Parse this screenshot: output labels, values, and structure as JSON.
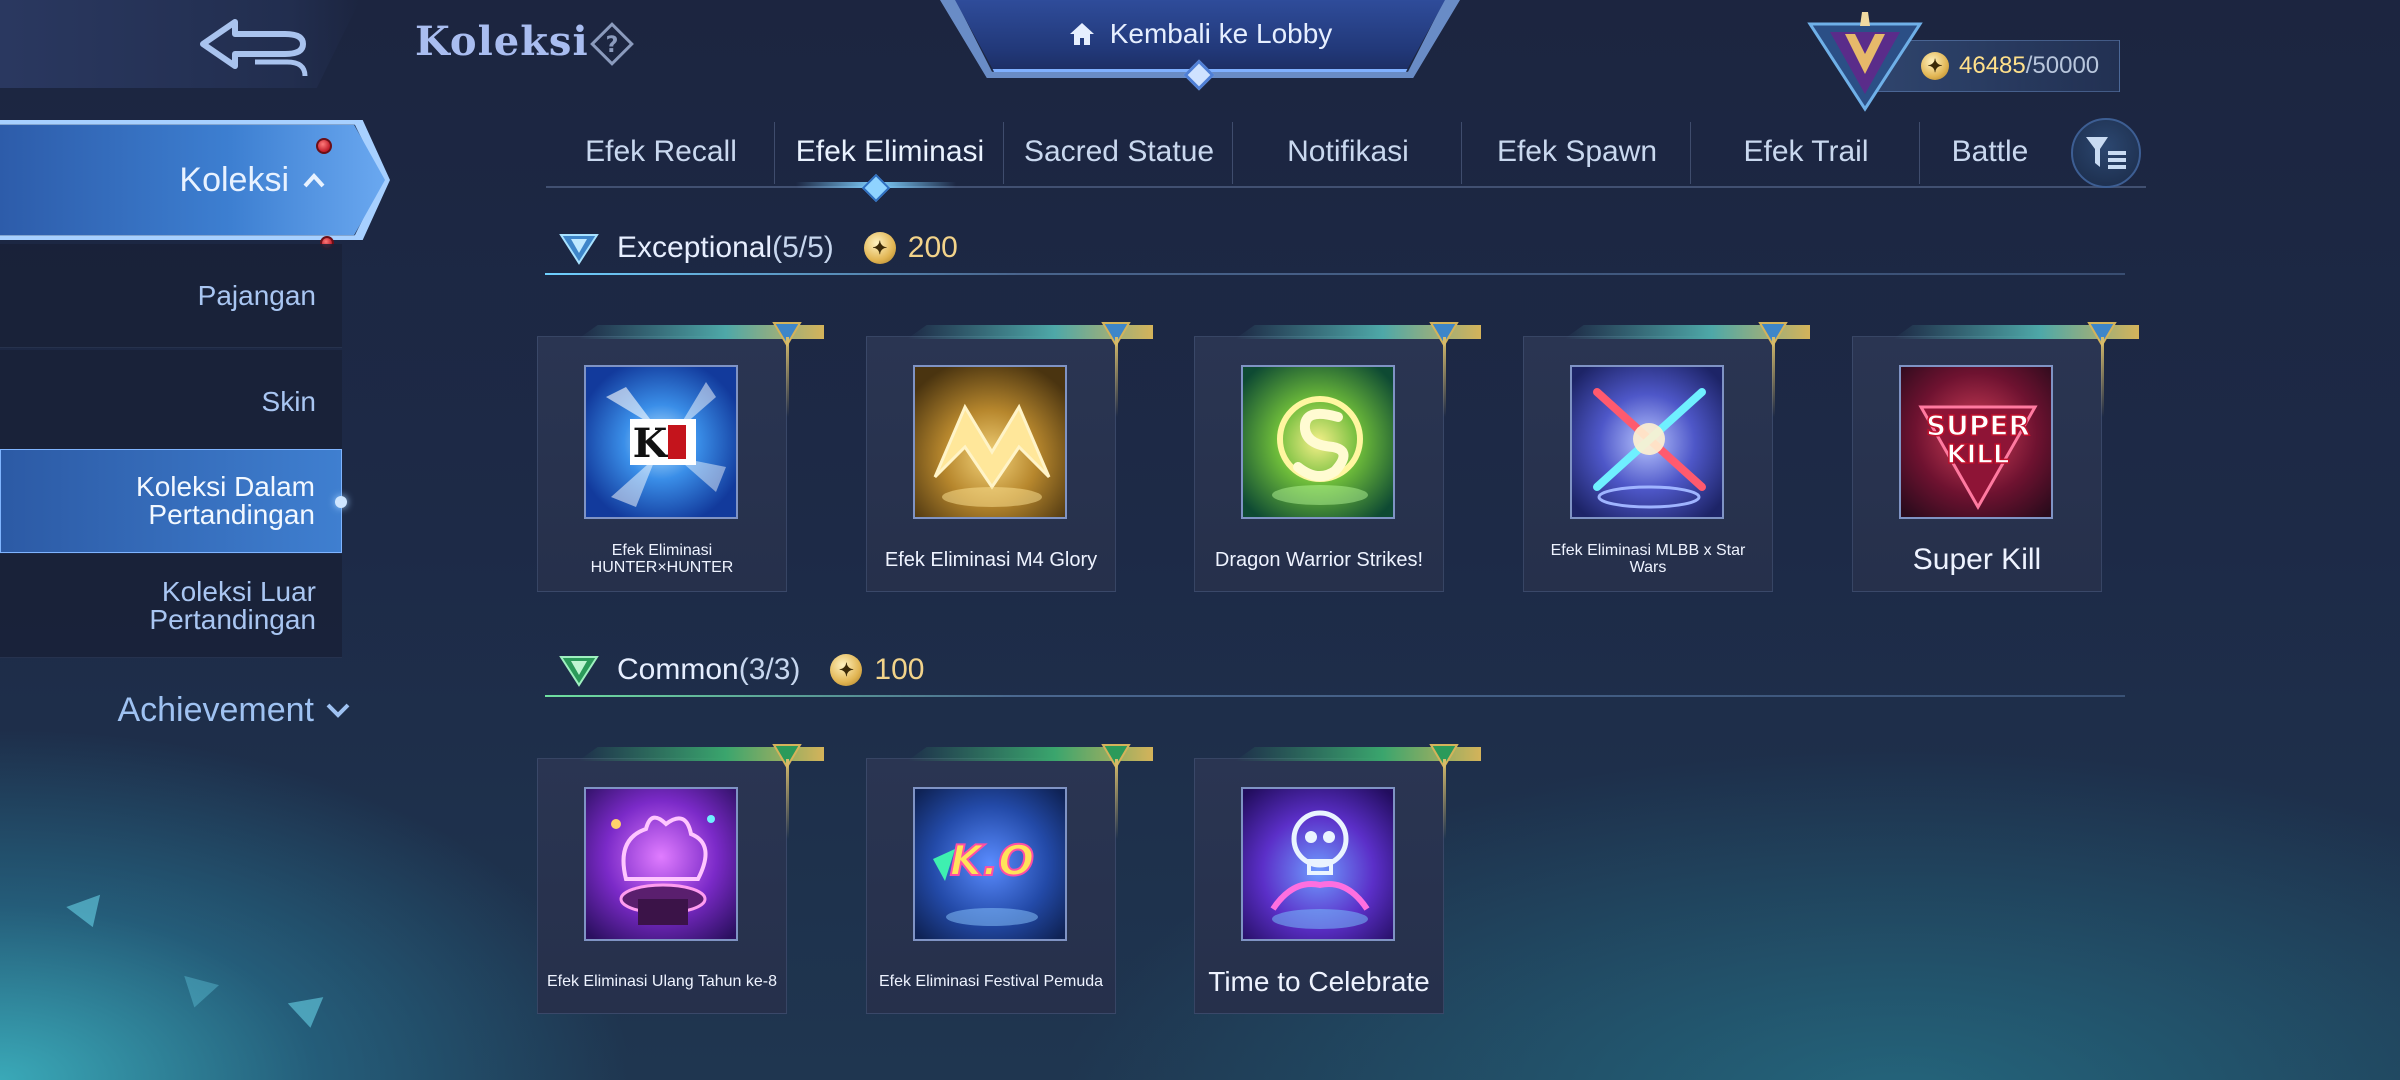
{
  "header": {
    "title": "Koleksi",
    "help_symbol": "?",
    "lobby_label": "Kembali ke Lobby",
    "points_current": "46485",
    "points_max": "/50000"
  },
  "sidebar": {
    "main": "Koleksi",
    "items": [
      {
        "label": "Pajangan"
      },
      {
        "label": "Skin"
      },
      {
        "label": "Koleksi Dalam Pertandingan"
      },
      {
        "label": "Koleksi Luar Pertandingan"
      }
    ],
    "achievement": "Achievement"
  },
  "tabs": [
    "Efek Recall",
    "Efek Eliminasi",
    "Sacred Statue",
    "Notifikasi",
    "Efek Spawn",
    "Efek Trail",
    "Battle"
  ],
  "sections": [
    {
      "name": "Exceptional",
      "count": "(5/5)",
      "reward": "200",
      "items": [
        {
          "label": "Efek Eliminasi HUNTER×HUNTER"
        },
        {
          "label": "Efek Eliminasi M4 Glory"
        },
        {
          "label": "Dragon Warrior Strikes!"
        },
        {
          "label": "Efek Eliminasi MLBB x Star Wars"
        },
        {
          "label": "Super Kill"
        }
      ]
    },
    {
      "name": "Common",
      "count": "(3/3)",
      "reward": "100",
      "items": [
        {
          "label": "Efek Eliminasi Ulang Tahun ke-8"
        },
        {
          "label": "Efek Eliminasi Festival Pemuda"
        },
        {
          "label": "Time to Celebrate"
        }
      ]
    }
  ],
  "thumb_text": {
    "hunter": "K",
    "superkill_1": "SUPER",
    "superkill_2": "KILL",
    "ko": "K.O"
  },
  "colors": {
    "accent_blue": "#3f7fd0",
    "gold": "#f2d38a",
    "badge_red": "#c01d2a"
  }
}
